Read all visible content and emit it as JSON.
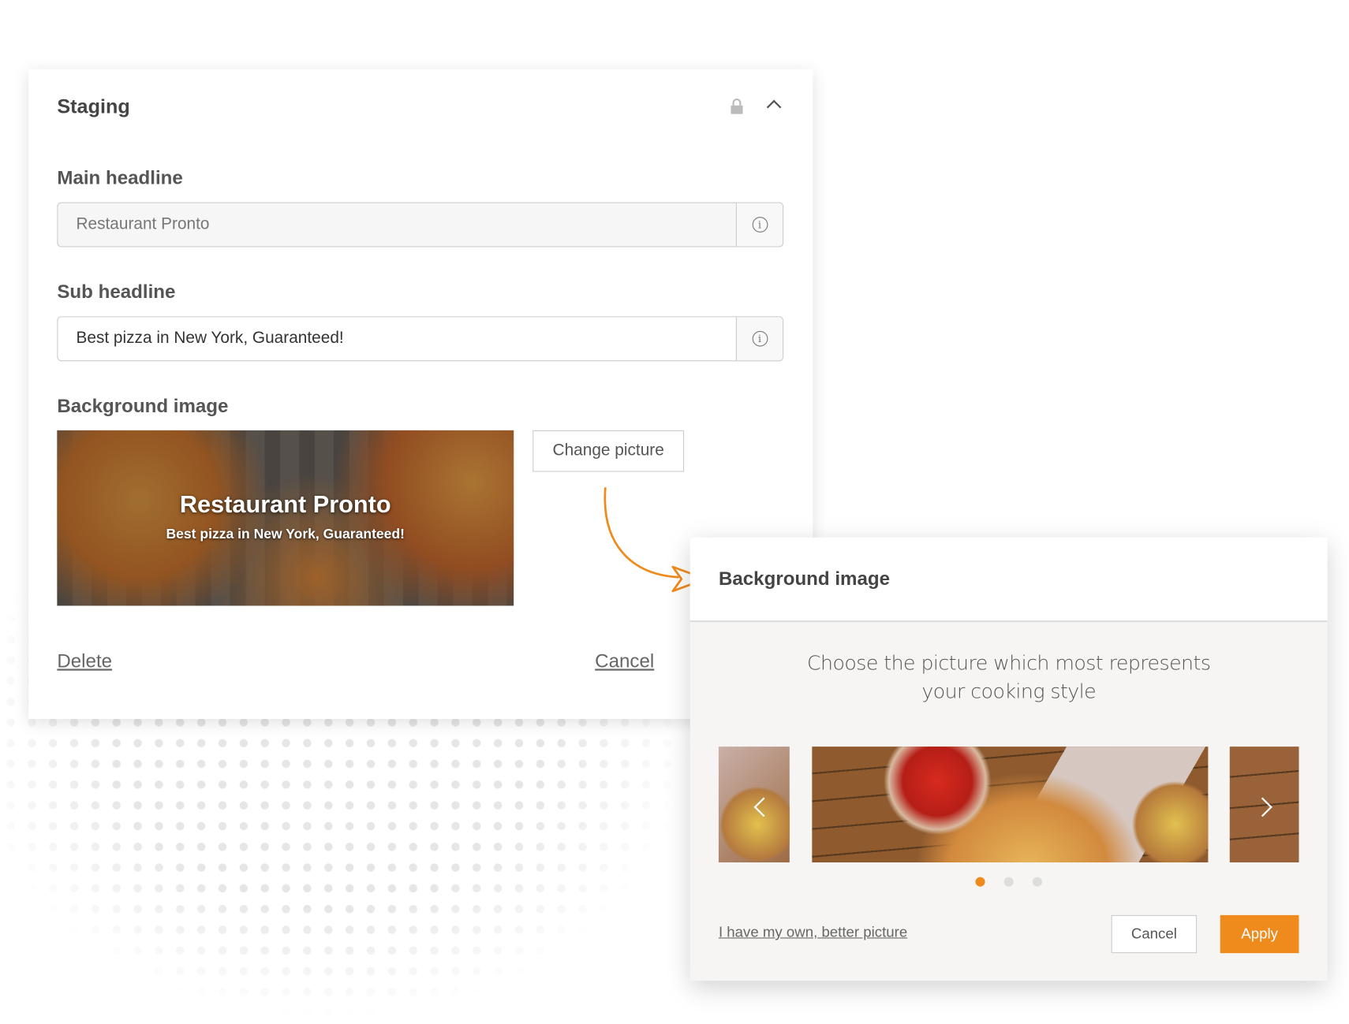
{
  "card": {
    "title": "Staging",
    "main_headline": {
      "label": "Main headline",
      "value": "Restaurant Pronto"
    },
    "sub_headline": {
      "label": "Sub headline",
      "value": "Best pizza in New York, Guaranteed!"
    },
    "background_image": {
      "label": "Background image",
      "preview_title": "Restaurant Pronto",
      "preview_subtitle": "Best pizza in New York, Guaranteed!",
      "change_label": "Change picture"
    },
    "delete_label": "Delete",
    "cancel_label": "Cancel",
    "icons": [
      "lock-icon",
      "chevron-up-icon",
      "info-icon"
    ]
  },
  "modal": {
    "title": "Background image",
    "description_line1": "Choose the picture which most represents",
    "description_line2": "your cooking style",
    "carousel": {
      "slides": 3,
      "active_index": 0
    },
    "own_picture_label": "I have my own, better picture",
    "cancel_label": "Cancel",
    "apply_label": "Apply"
  },
  "colors": {
    "accent": "#ef8b1c",
    "text": "#444444"
  }
}
